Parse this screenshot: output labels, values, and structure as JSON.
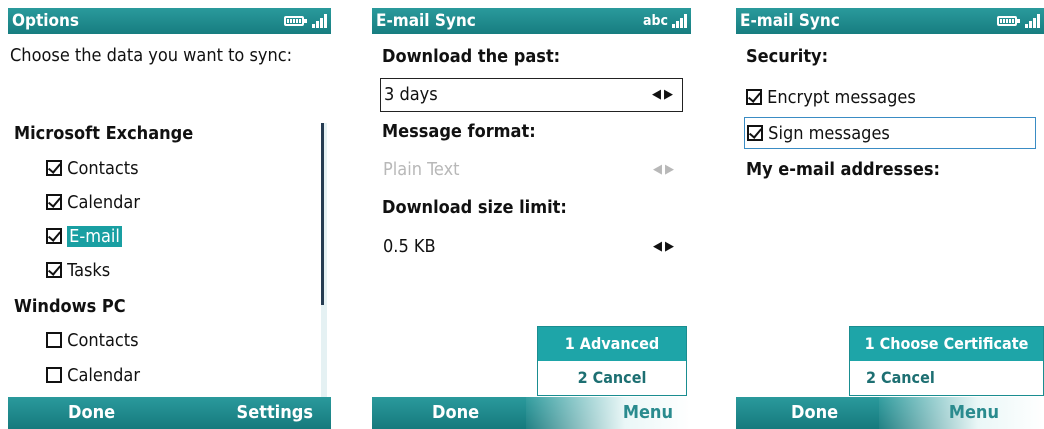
{
  "screens": [
    {
      "title": "Options",
      "prompt": "Choose the data you want to sync:",
      "groups": [
        {
          "header": "Microsoft Exchange",
          "items": [
            {
              "label": "Contacts",
              "checked": true
            },
            {
              "label": "Calendar",
              "checked": true
            },
            {
              "label": "E-mail",
              "checked": true,
              "highlighted": true
            },
            {
              "label": "Tasks",
              "checked": true
            }
          ]
        },
        {
          "header": "Windows PC",
          "items": [
            {
              "label": "Contacts",
              "checked": false
            },
            {
              "label": "Calendar",
              "checked": false
            }
          ]
        }
      ],
      "softkeys": {
        "left": "Done",
        "right": "Settings"
      }
    },
    {
      "title": "E-mail Sync",
      "input_mode": "abc",
      "fields": [
        {
          "label": "Download the past:",
          "value": "3 days",
          "focused": true,
          "disabled": false
        },
        {
          "label": "Message format:",
          "value": "Plain Text",
          "focused": false,
          "disabled": true
        },
        {
          "label": "Download size limit:",
          "value": "0.5 KB",
          "focused": false,
          "disabled": false
        }
      ],
      "menu": {
        "items": [
          "1 Advanced",
          "2 Cancel"
        ],
        "selected": 0
      },
      "softkeys": {
        "left": "Done",
        "right": "Menu"
      }
    },
    {
      "title": "E-mail Sync",
      "security_header": "Security:",
      "options": [
        {
          "label": "Encrypt messages",
          "checked": true,
          "focused": false
        },
        {
          "label": "Sign messages",
          "checked": true,
          "focused": true
        }
      ],
      "addresses_header": "My e-mail addresses:",
      "menu": {
        "items": [
          "1 Choose Certificate",
          "2 Cancel"
        ],
        "selected": 0
      },
      "softkeys": {
        "left": "Done",
        "right": "Menu"
      }
    }
  ]
}
